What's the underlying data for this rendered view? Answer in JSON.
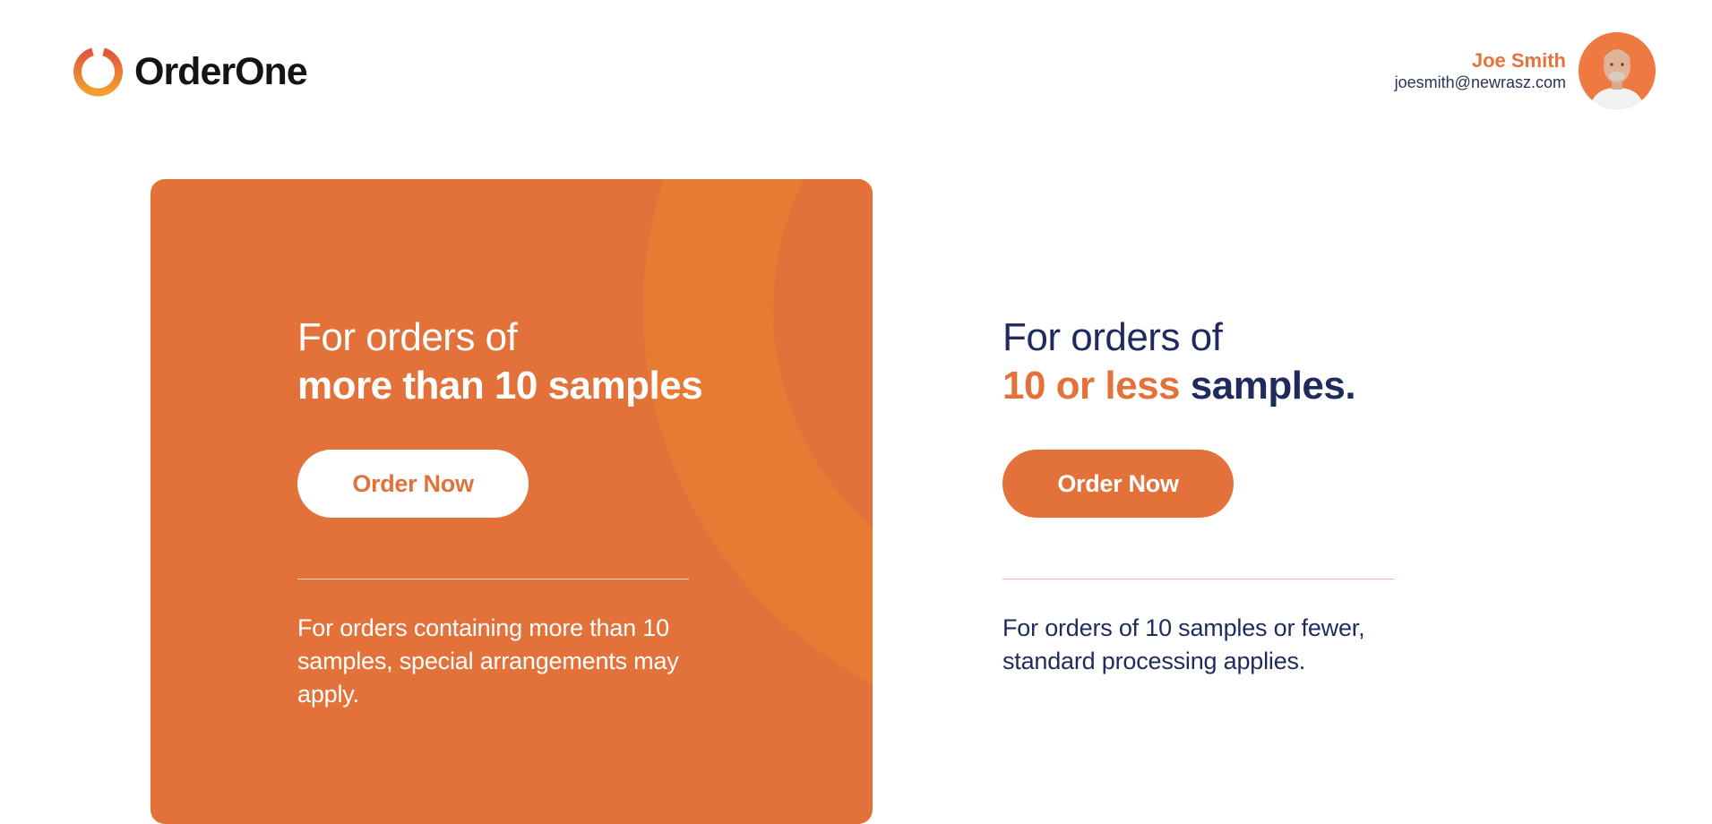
{
  "header": {
    "logo_text": "OrderOne",
    "user": {
      "name": "Joe Smith",
      "email": "joesmith@newrasz.com"
    }
  },
  "large_order_card": {
    "heading_line1": "For orders of",
    "heading_line2": "more than 10 samples",
    "button_label": "Order Now",
    "description": "For orders containing more than 10 samples, special arrangements may apply."
  },
  "small_order_card": {
    "heading_line1": "For orders of",
    "heading_highlight": "10 or less",
    "heading_rest": " samples.",
    "button_label": "Order Now",
    "description": "For orders of 10 samples or fewer, standard processing applies."
  },
  "colors": {
    "brand_orange": "#e3723a",
    "navy": "#1f2b5c",
    "divider_pink": "#e8b4b4"
  }
}
